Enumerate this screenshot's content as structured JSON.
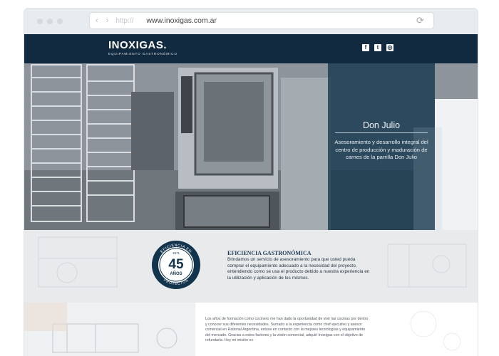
{
  "browser": {
    "protocol": "http://",
    "url": "www.inoxigas.com.ar",
    "nav_arrows": "‹ ›",
    "refresh_icon": "⟳"
  },
  "header": {
    "logo_name": "INOXIGAS.",
    "logo_tagline": "EQUIPAMIENTO GASTRONÓMICO",
    "social": {
      "facebook": "f",
      "twitter": "t",
      "instagram": "◎"
    }
  },
  "hero": {
    "title": "Don Julio",
    "description": "Asesoramiento y desarrollo integral del centro de producción y maduración de carnes de la parrilla Don Julio"
  },
  "badge": {
    "top_text": "EFICIENCIA EN",
    "bottom_text": "PROYECTOS",
    "since": "1971",
    "number": "45",
    "unit": "AÑOS"
  },
  "efficiency": {
    "title": "EFICIENCIA GASTRONÓMICA",
    "text": "Brindamos un servicio de asesoramiento para que usted pueda comprar el equipamiento adecuado a la necesidad del proyecto, entendiendo como se usa el producto debido a nuestra experiencia en la utilización y aplicación de los mismos."
  },
  "about": {
    "text": "Los años de formación como cocinero me han dado la oportunidad de vivir las cocinas por dentro y conocer sus diferentes necesidades. Sumado a la experiencia como chef ejecutivo y asesor comercial en Rational Argentina, estuve en contacto con la mejores tecnologías y equipamiento del mercado. Gracias a estos factores y la visión comercial, adquirí Inoxigas con el objetivo de refundarla. Hoy mi misión es"
  },
  "colors": {
    "header_bg": "#122a3f",
    "panel_bg": "#12344c",
    "accent": "#1d3a55"
  }
}
